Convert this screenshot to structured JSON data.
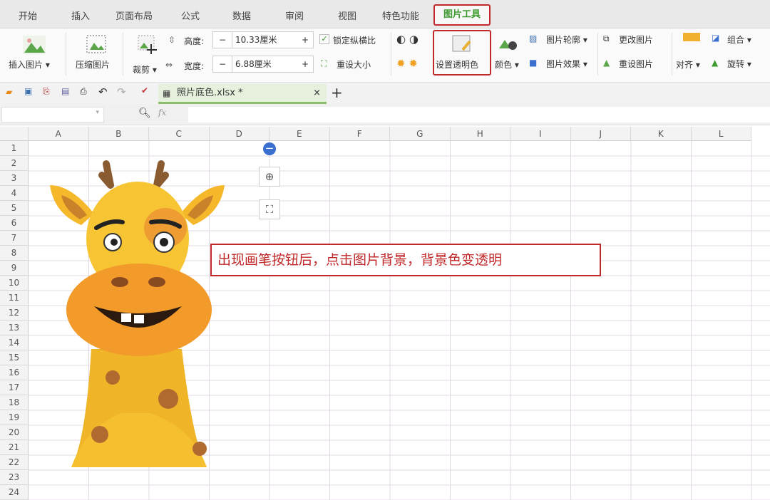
{
  "tabs": [
    "开始",
    "插入",
    "页面布局",
    "公式",
    "数据",
    "审阅",
    "视图",
    "特色功能"
  ],
  "active_tab": "图片工具",
  "ribbon": {
    "insert_picture": "插入图片 ▾",
    "compress": "压缩图片",
    "crop": "裁剪 ▾",
    "height_label": "高度:",
    "height_value": "10.33厘米",
    "width_label": "宽度:",
    "width_value": "6.88厘米",
    "lock_ratio": "锁定纵横比",
    "reset_size": "重设大小",
    "set_transparent": "设置透明色",
    "color": "颜色 ▾",
    "outline": "图片轮廓 ▾",
    "effects": "图片效果 ▾",
    "change_picture": "更改图片",
    "reset_picture": "重设图片",
    "align": "对齐 ▾",
    "group": "组合 ▾",
    "rotate": "旋转 ▾",
    "minus": "−",
    "plus": "+"
  },
  "file_tab": {
    "name": "照片底色.xlsx *",
    "close": "×",
    "new": "+"
  },
  "formula_bar": {
    "fx": "fx"
  },
  "columns": [
    "A",
    "B",
    "C",
    "D",
    "E",
    "F",
    "G",
    "H",
    "I",
    "J",
    "K",
    "L"
  ],
  "rows": [
    "1",
    "2",
    "3",
    "4",
    "5",
    "6",
    "7",
    "8",
    "9",
    "10",
    "11",
    "12",
    "13",
    "14",
    "15",
    "16",
    "17",
    "18",
    "19",
    "20",
    "21",
    "22",
    "23",
    "24"
  ],
  "callout": "出现画笔按钮后，点击图片背景，背景色变透明",
  "colors": {
    "accent": "#c0282a",
    "green": "#3c9a2e"
  }
}
